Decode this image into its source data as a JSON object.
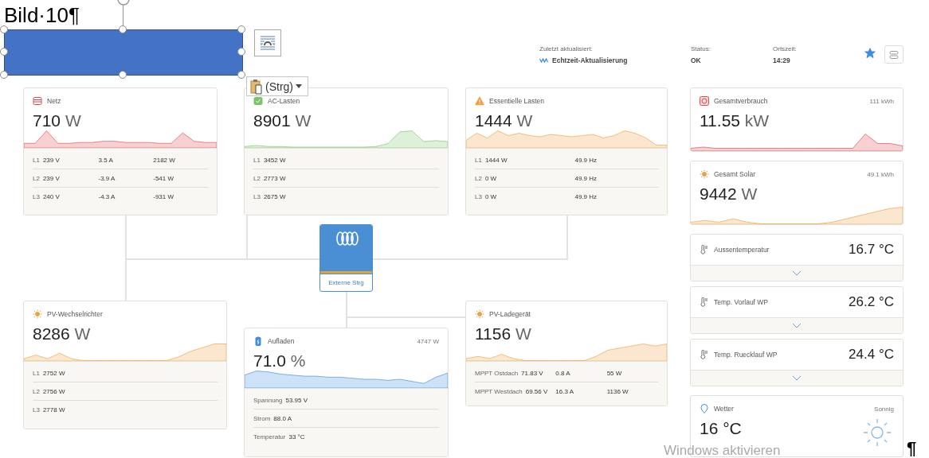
{
  "document": {
    "caption": "Bild·10¶",
    "paste_button": "(Strg)",
    "end_mark": "¶"
  },
  "header": {
    "last_updated_label": "Zuletzt aktualisiert:",
    "last_updated_value": "Echtzeit-Aktualisierung",
    "status_label": "Status:",
    "status_value": "OK",
    "time_label": "Ortszeit:",
    "time_value": "14:29",
    "favorite": true
  },
  "diagram": {
    "cards": [
      {
        "title": "Netz",
        "value": "710",
        "unit": "W",
        "color": "#e0474c",
        "rows": [
          [
            "L1",
            "239 V",
            "3.5 A",
            "2182 W"
          ],
          [
            "L2",
            "239 V",
            "-3.9 A",
            "-541 W"
          ],
          [
            "L3",
            "240 V",
            "-4.3 A",
            "-931 W"
          ]
        ]
      },
      {
        "title": "AC-Lasten",
        "value": "8901",
        "unit": "W",
        "color": "#7ac46b",
        "rows": [
          [
            "L1",
            "3452 W"
          ],
          [
            "L2",
            "2773 W"
          ],
          [
            "L3",
            "2675 W"
          ]
        ]
      },
      {
        "title": "Essentielle Lasten",
        "value": "1444",
        "unit": "W",
        "color": "#f0a040",
        "rows": [
          [
            "L1",
            "1444 W",
            "49.9 Hz"
          ],
          [
            "L2",
            "0 W",
            "49.9 Hz"
          ],
          [
            "L3",
            "0 W",
            "49.9 Hz"
          ]
        ]
      },
      {
        "title": "PV-Wechselrichter",
        "value": "8286",
        "unit": "W",
        "color": "#f0a040",
        "rows": [
          [
            "L1",
            "2752 W"
          ],
          [
            "L2",
            "2756 W"
          ],
          [
            "L3",
            "2778 W"
          ]
        ]
      },
      {
        "title": "Aufladen",
        "value": "71.0",
        "unit": "%",
        "total": "4747 W",
        "color": "#3d8de0",
        "rows": [
          [
            "Spannung",
            "53.95 V"
          ],
          [
            "Strom",
            "88.0 A"
          ],
          [
            "Temperatur",
            "33 °C"
          ]
        ]
      },
      {
        "title": "PV-Ladegerät",
        "value": "1156",
        "unit": "W",
        "color": "#f0a040",
        "rows": [
          [
            "MPPT Ostdach",
            "71.83 V",
            "0.8 A",
            "55 W"
          ],
          [
            "MPPT Westdach",
            "69.56 V",
            "16.3 A",
            "1136 W"
          ]
        ]
      }
    ],
    "hub": {
      "label": "Externe Strg"
    }
  },
  "sidebar": [
    {
      "kind": "stat",
      "title": "Gesamtverbrauch",
      "value": "11.55",
      "unit": "kW",
      "total": "111 kWh",
      "color": "#e0474c"
    },
    {
      "kind": "stat",
      "title": "Gesamt Solar",
      "value": "9442",
      "unit": "W",
      "total": "49.1 kWh",
      "color": "#f0a040"
    },
    {
      "kind": "temperature",
      "title": "Aussentemperatur",
      "value": "16.7 °C",
      "expanded": false
    },
    {
      "kind": "temperature",
      "title": "Temp. Vorlauf WP",
      "value": "26.2 °C",
      "expanded": false
    },
    {
      "kind": "temperature",
      "title": "Temp. Ruecklauf WP",
      "value": "24.4 °C",
      "expanded": false
    },
    {
      "kind": "weather",
      "title": "Wetter",
      "value": "16 °C",
      "condition": "Sonnig"
    }
  ],
  "os_notice": "Windows aktivieren"
}
